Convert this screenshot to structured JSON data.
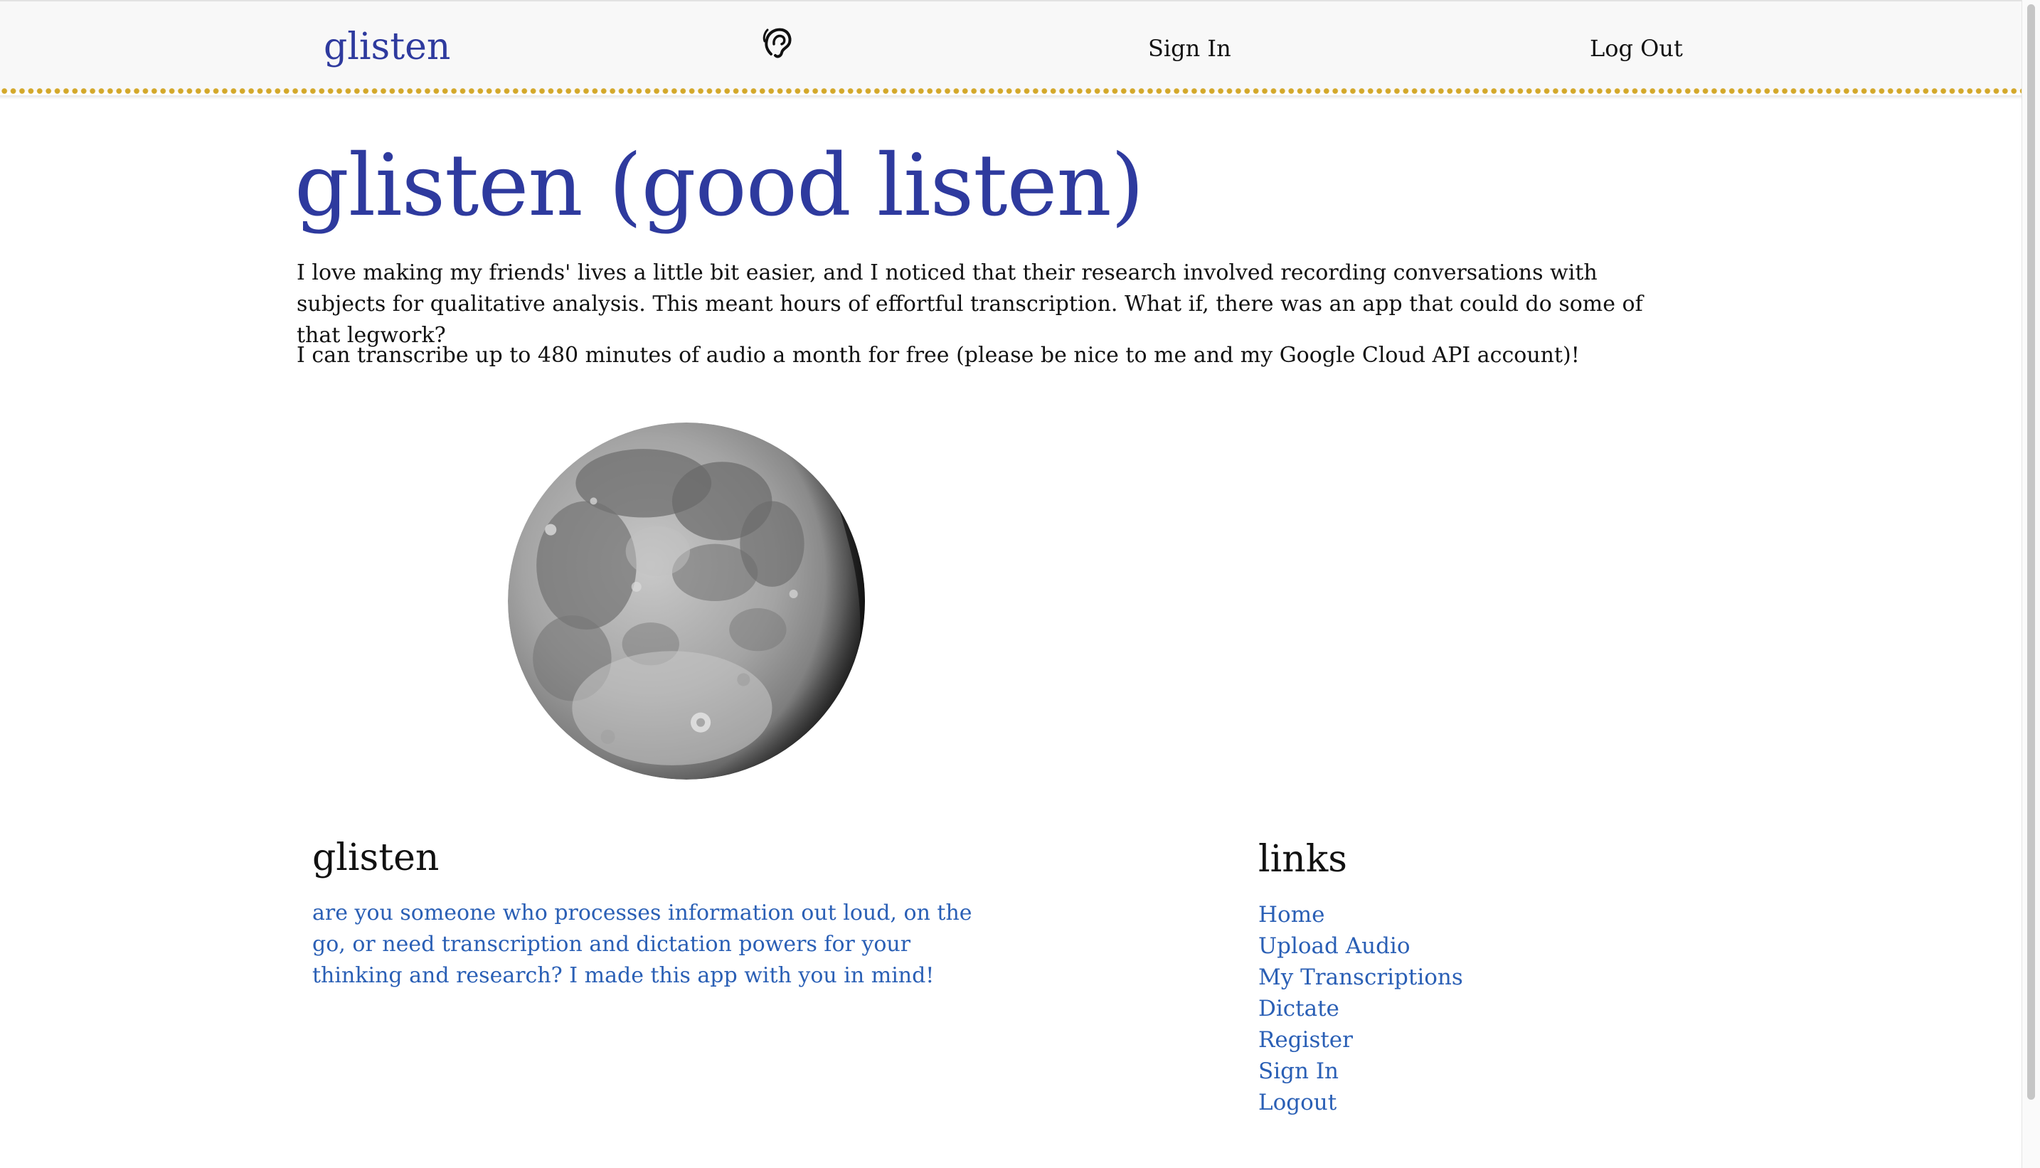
{
  "navbar": {
    "brand": "glisten",
    "icon": "ear-icon",
    "links": [
      "Sign In",
      "Log Out"
    ]
  },
  "main": {
    "title": "glisten (good listen)",
    "paragraphs": [
      "I love making my friends' lives a little bit easier, and I noticed that their research involved recording conversations with subjects for qualitative analysis. This meant hours of effortful transcription. What if, there was an app that could do some of that legwork?",
      "I can transcribe up to 480 minutes of audio a month for free (please be nice to me and my Google Cloud API account)!"
    ]
  },
  "footer": {
    "about_title": "glisten",
    "about_text": "are you someone who processes information out loud, on the go, or need transcription and dictation powers for your thinking and research? I made this app with you in mind!",
    "links_title": "links",
    "links": [
      "Home",
      "Upload Audio",
      "My Transcriptions",
      "Dictate",
      "Register",
      "Sign In",
      "Logout"
    ]
  },
  "colors": {
    "brand": "#2e3a9e",
    "link": "#2a5fb5",
    "accent_dots": "#d4a82a"
  }
}
